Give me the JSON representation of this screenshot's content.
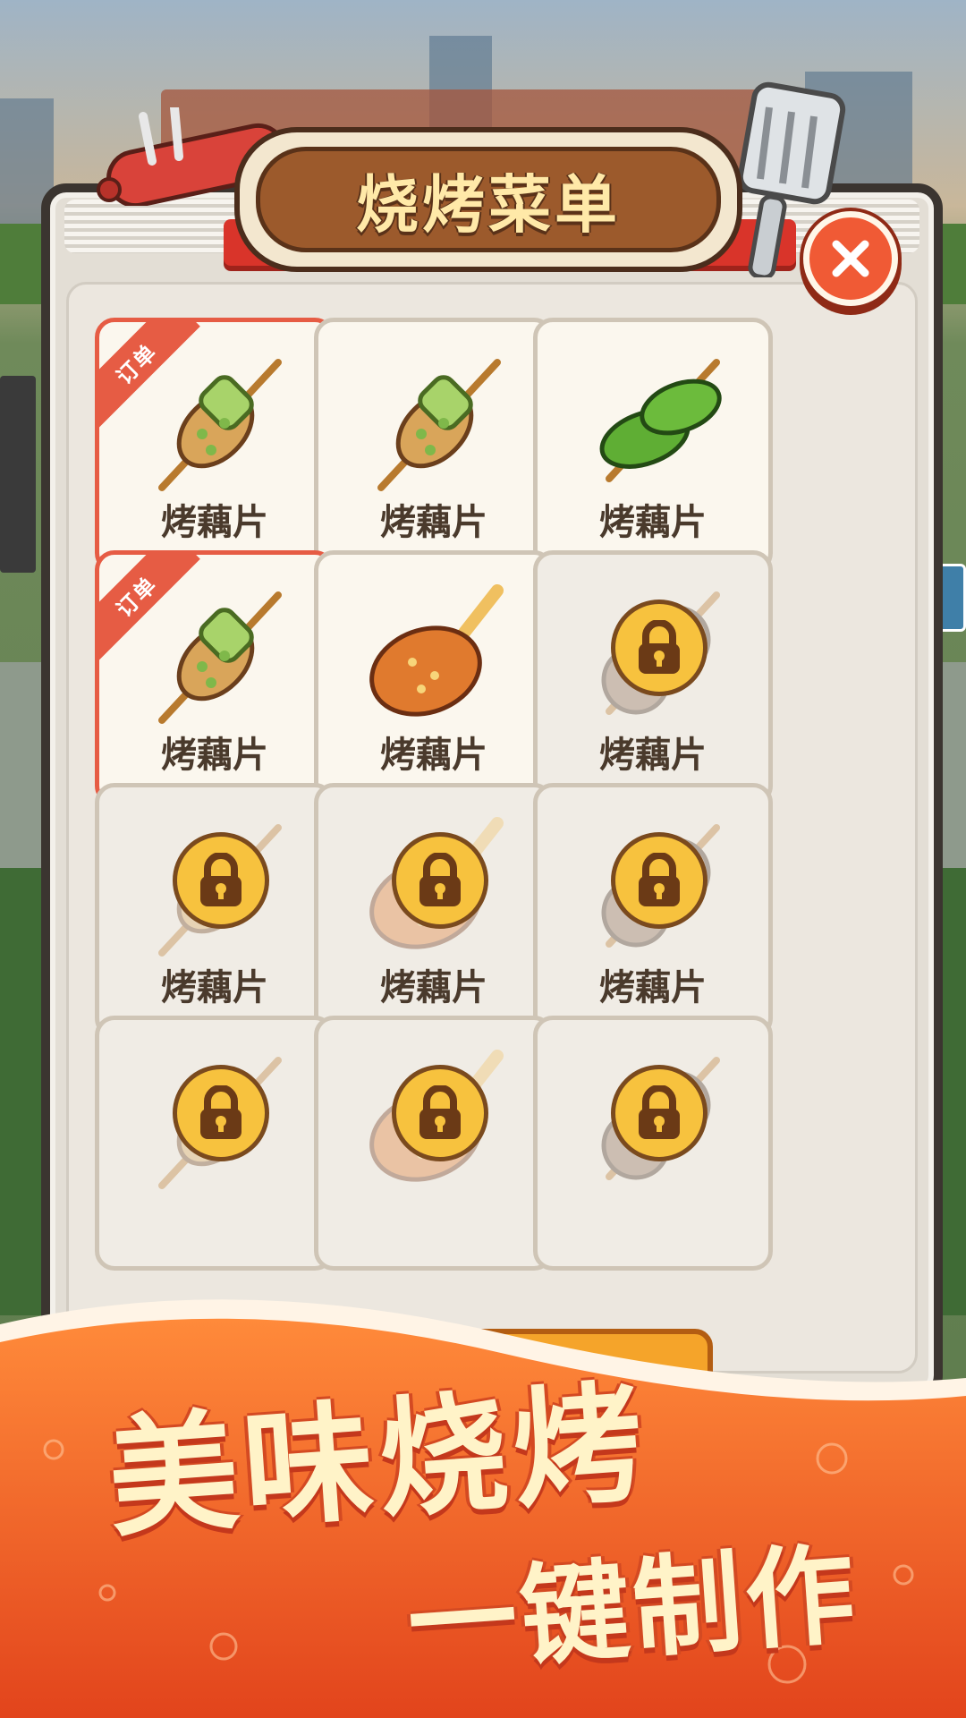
{
  "header": {
    "title": "烧烤菜单"
  },
  "close_button": {
    "icon": "close-icon"
  },
  "menu_items": [
    {
      "label": "烤藕片",
      "food": "lotus-skewer",
      "locked": false,
      "order_tag": "订单"
    },
    {
      "label": "烤藕片",
      "food": "lotus-skewer",
      "locked": false
    },
    {
      "label": "烤藕片",
      "food": "pepper-skewer",
      "locked": false
    },
    {
      "label": "烤藕片",
      "food": "lotus-skewer",
      "locked": false,
      "order_tag": "订单"
    },
    {
      "label": "烤藕片",
      "food": "drumstick",
      "locked": false
    },
    {
      "label": "烤藕片",
      "food": "mushroom-skewer",
      "locked": true
    },
    {
      "label": "烤藕片",
      "food": "lotus-skewer",
      "locked": true
    },
    {
      "label": "烤藕片",
      "food": "drumstick",
      "locked": true
    },
    {
      "label": "烤藕片",
      "food": "mushroom-skewer",
      "locked": true
    },
    {
      "label": "",
      "food": "lotus-skewer",
      "locked": true
    },
    {
      "label": "",
      "food": "drumstick",
      "locked": true
    },
    {
      "label": "",
      "food": "mushroom-skewer",
      "locked": true
    }
  ],
  "promo": {
    "line1": "美味烧烤",
    "line2": "一键制作"
  },
  "colors": {
    "accent_red": "#e65c44",
    "banner_orange": "#f26a2a",
    "lock_gold": "#f7c23e"
  }
}
